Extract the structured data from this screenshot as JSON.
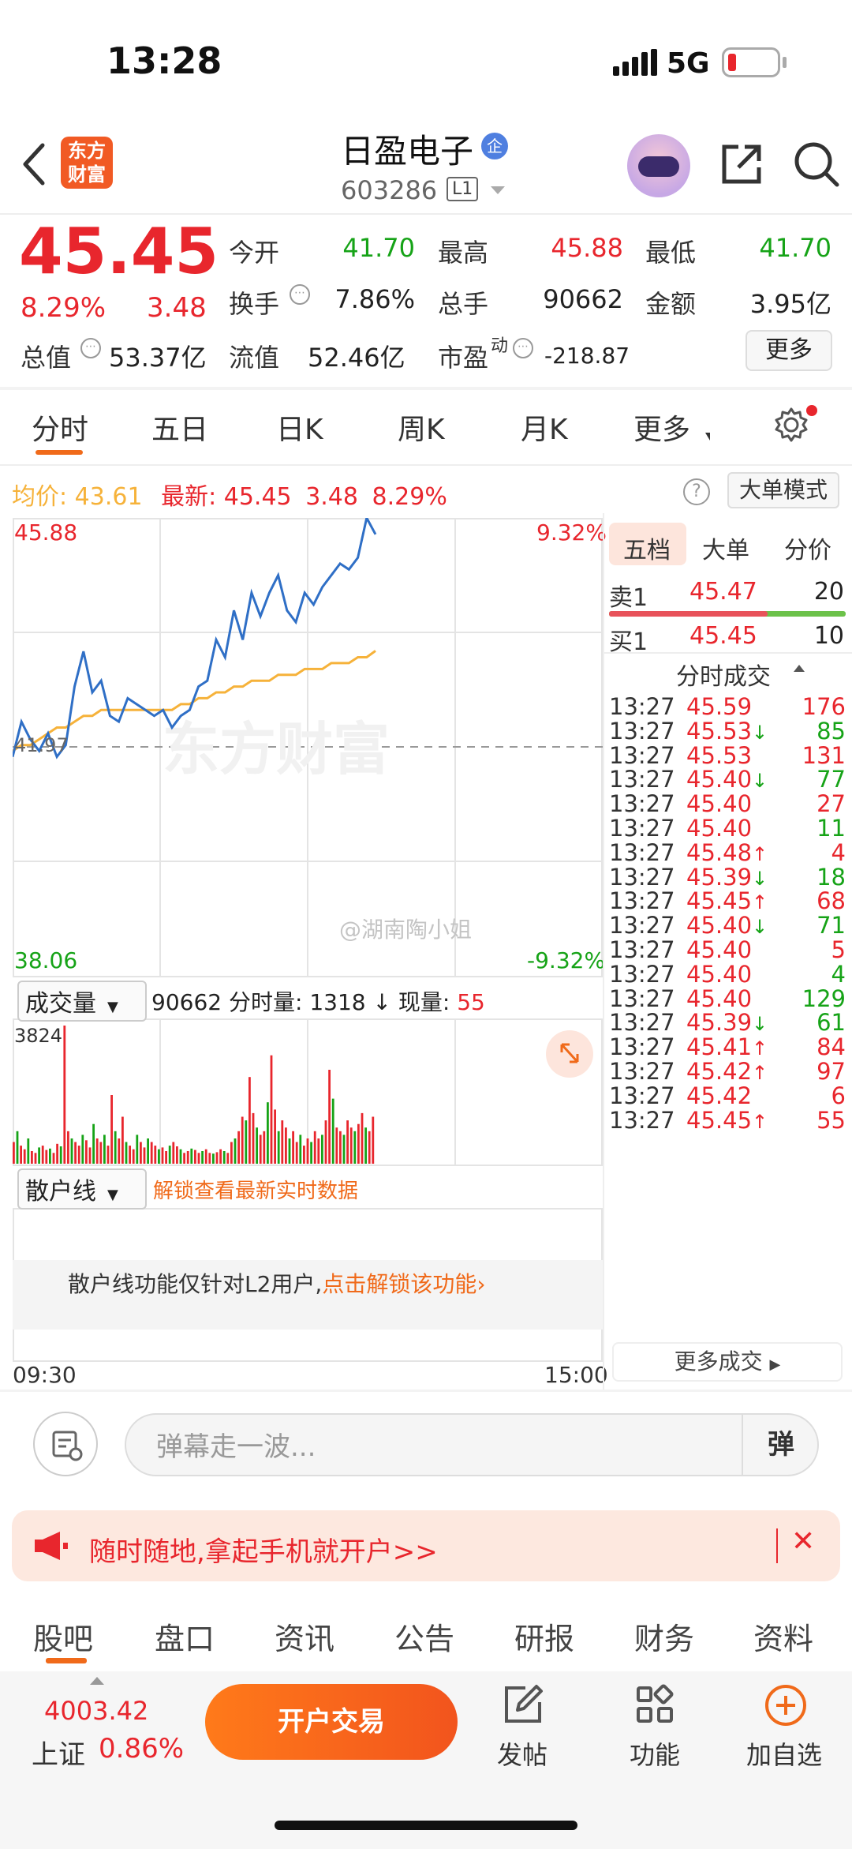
{
  "status_bar": {
    "time": "13:28",
    "network": "5G"
  },
  "header": {
    "logo_line1": "东方",
    "logo_line2": "财富",
    "stock_name": "日盈电子",
    "badge": "企",
    "stock_code": "603286",
    "level": "L1"
  },
  "quote": {
    "price": "45.45",
    "change_pct": "8.29%",
    "change_amt": "3.48",
    "fields": {
      "open_label": "今开",
      "open": "41.70",
      "high_label": "最高",
      "high": "45.88",
      "low_label": "最低",
      "low": "41.70",
      "turnover_label": "换手",
      "turnover": "7.86%",
      "volume_label": "总手",
      "volume": "90662",
      "amount_label": "金额",
      "amount": "3.95亿",
      "mktcap_label": "总值",
      "mktcap": "53.37亿",
      "float_label": "流值",
      "float": "52.46亿",
      "pe_label": "市盈",
      "pe_sup": "动",
      "pe": "-218.87"
    },
    "more_label": "更多"
  },
  "chart_tabs": [
    "分时",
    "五日",
    "日K",
    "周K",
    "月K",
    "更多"
  ],
  "info_line": {
    "avg_label": "均价:",
    "avg_value": "43.61",
    "latest_label": "最新:",
    "latest_price": "45.45",
    "latest_chg": "3.48",
    "latest_pct": "8.29%",
    "big_order_mode": "大单模式"
  },
  "chart_labels": {
    "top_price": "45.88",
    "bottom_price": "38.06",
    "mid_price": "41.97",
    "top_pct": "9.32%",
    "bottom_pct": "-9.32%",
    "watermark": "东方财富",
    "credit": "@湖南陶小姐",
    "start_time": "09:30",
    "end_time": "15:00"
  },
  "chart_data": {
    "type": "line",
    "x_range": [
      "09:30",
      "15:00"
    ],
    "ylim": [
      38.06,
      45.88
    ],
    "prev_close": 41.97,
    "series": [
      {
        "name": "价格",
        "color": "#2f6fc6",
        "values": [
          41.8,
          42.4,
          42.1,
          41.9,
          42.2,
          41.8,
          42.0,
          43.0,
          43.6,
          42.9,
          43.1,
          42.5,
          42.4,
          42.8,
          42.7,
          42.6,
          42.5,
          42.6,
          42.3,
          42.5,
          42.6,
          43.0,
          43.1,
          43.8,
          43.5,
          44.3,
          43.8,
          44.6,
          44.2,
          44.6,
          44.9,
          44.3,
          44.1,
          44.6,
          44.4,
          44.7,
          44.9,
          45.1,
          45.0,
          45.2,
          45.88,
          45.6
        ]
      },
      {
        "name": "均价",
        "color": "#f6b23a",
        "values": [
          41.9,
          42.0,
          42.0,
          42.1,
          42.2,
          42.3,
          42.3,
          42.4,
          42.5,
          42.5,
          42.6,
          42.6,
          42.6,
          42.6,
          42.6,
          42.6,
          42.6,
          42.6,
          42.6,
          42.7,
          42.7,
          42.8,
          42.8,
          42.9,
          42.9,
          43.0,
          43.0,
          43.1,
          43.1,
          43.1,
          43.2,
          43.2,
          43.2,
          43.3,
          43.3,
          43.3,
          43.4,
          43.4,
          43.4,
          43.5,
          43.5,
          43.61
        ]
      }
    ]
  },
  "volume": {
    "selector": "成交量",
    "total": "90662",
    "min_label": "分时量:",
    "min_value": "1318",
    "now_label": "现量:",
    "now_value": "55",
    "max_label": "3824",
    "bars": [
      600,
      900,
      500,
      400,
      700,
      350,
      300,
      450,
      500,
      380,
      420,
      300,
      550,
      480,
      3824,
      900,
      700,
      600,
      500,
      800,
      650,
      450,
      1100,
      700,
      600,
      800,
      500,
      1900,
      900,
      700,
      1300,
      600,
      500,
      400,
      800,
      600,
      450,
      700,
      600,
      500,
      400,
      450,
      350,
      500,
      600,
      480,
      400,
      300,
      350,
      420,
      380,
      300,
      350,
      400,
      300,
      280,
      320,
      400,
      350,
      300,
      600,
      700,
      900,
      1300,
      1200,
      2400,
      1400,
      1000,
      800,
      900,
      1700,
      3000,
      1500,
      900,
      1200,
      1000,
      700,
      900,
      600,
      800,
      500,
      700,
      600,
      900,
      700,
      800,
      1200,
      2600,
      1800,
      1000,
      900,
      800,
      1200,
      1000,
      900,
      1100,
      1400,
      1000,
      900,
      1300
    ]
  },
  "retail": {
    "selector": "散户线",
    "unlock_hint": "解锁查看最新实时数据",
    "message": "散户线功能仅针对L2用户,",
    "message_link": "点击解锁该功能"
  },
  "orderbook": {
    "tabs": [
      "五档",
      "大单",
      "分价"
    ],
    "sell_label": "卖1",
    "sell_price": "45.47",
    "sell_qty": "20",
    "buy_label": "买1",
    "buy_price": "45.45",
    "buy_qty": "10",
    "sell_ratio": 0.67,
    "trades_title": "分时成交",
    "trades": [
      {
        "time": "13:27",
        "price": "45.59",
        "dir": "",
        "qty": "176",
        "color": "red"
      },
      {
        "time": "13:27",
        "price": "45.53",
        "dir": "↓",
        "qty": "85",
        "color": "green"
      },
      {
        "time": "13:27",
        "price": "45.53",
        "dir": "",
        "qty": "131",
        "color": "red"
      },
      {
        "time": "13:27",
        "price": "45.40",
        "dir": "↓",
        "qty": "77",
        "color": "green"
      },
      {
        "time": "13:27",
        "price": "45.40",
        "dir": "",
        "qty": "27",
        "color": "red"
      },
      {
        "time": "13:27",
        "price": "45.40",
        "dir": "",
        "qty": "11",
        "color": "green"
      },
      {
        "time": "13:27",
        "price": "45.48",
        "dir": "↑",
        "qty": "4",
        "color": "red"
      },
      {
        "time": "13:27",
        "price": "45.39",
        "dir": "↓",
        "qty": "18",
        "color": "green"
      },
      {
        "time": "13:27",
        "price": "45.45",
        "dir": "↑",
        "qty": "68",
        "color": "red"
      },
      {
        "time": "13:27",
        "price": "45.40",
        "dir": "↓",
        "qty": "71",
        "color": "green"
      },
      {
        "time": "13:27",
        "price": "45.40",
        "dir": "",
        "qty": "5",
        "color": "red"
      },
      {
        "time": "13:27",
        "price": "45.40",
        "dir": "",
        "qty": "4",
        "color": "green"
      },
      {
        "time": "13:27",
        "price": "45.40",
        "dir": "",
        "qty": "129",
        "color": "green"
      },
      {
        "time": "13:27",
        "price": "45.39",
        "dir": "↓",
        "qty": "61",
        "color": "green"
      },
      {
        "time": "13:27",
        "price": "45.41",
        "dir": "↑",
        "qty": "84",
        "color": "red"
      },
      {
        "time": "13:27",
        "price": "45.42",
        "dir": "↑",
        "qty": "97",
        "color": "red"
      },
      {
        "time": "13:27",
        "price": "45.42",
        "dir": "",
        "qty": "6",
        "color": "red"
      },
      {
        "time": "13:27",
        "price": "45.45",
        "dir": "↑",
        "qty": "55",
        "color": "red"
      }
    ],
    "more_trades": "更多成交"
  },
  "comment": {
    "placeholder": "弹幕走一波...",
    "dan_label": "弹"
  },
  "banner": {
    "text": "随时随地,拿起手机就开户>>",
    "close": "✕"
  },
  "bottom_tabs": [
    "股吧",
    "盘口",
    "资讯",
    "公告",
    "研报",
    "财务",
    "资料"
  ],
  "bottom_bar": {
    "index_value": "4003.42",
    "index_name": "上证",
    "index_pct": "0.86%",
    "trade_button": "开户交易",
    "post_label": "发帖",
    "func_label": "功能",
    "watch_label": "加自选"
  },
  "colors": {
    "up": "#e8262d",
    "down": "#16a317",
    "accent": "#f06a1a",
    "price_line": "#2f6fc6",
    "avg_line": "#f6b23a"
  }
}
